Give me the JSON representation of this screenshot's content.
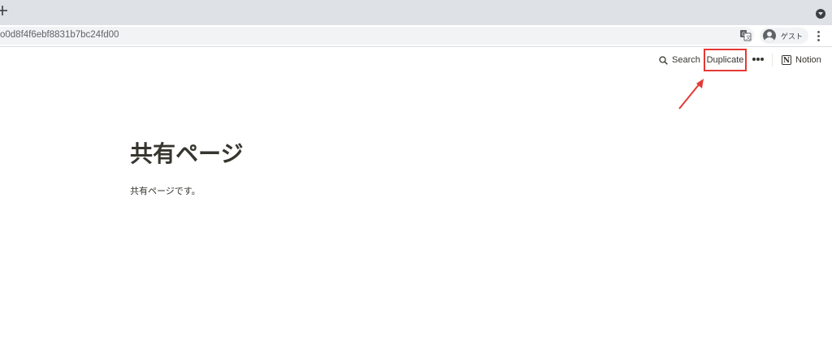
{
  "browser": {
    "url": "o0d8f4f6ebf8831b7bc24fd00",
    "profile_label": "ゲスト"
  },
  "topbar": {
    "search_label": "Search",
    "duplicate_label": "Duplicate",
    "notion_label": "Notion",
    "notion_logo_letter": "N"
  },
  "page": {
    "title": "共有ページ",
    "body": "共有ページです。"
  },
  "colors": {
    "highlight": "#e53935",
    "text": "#37352f"
  }
}
